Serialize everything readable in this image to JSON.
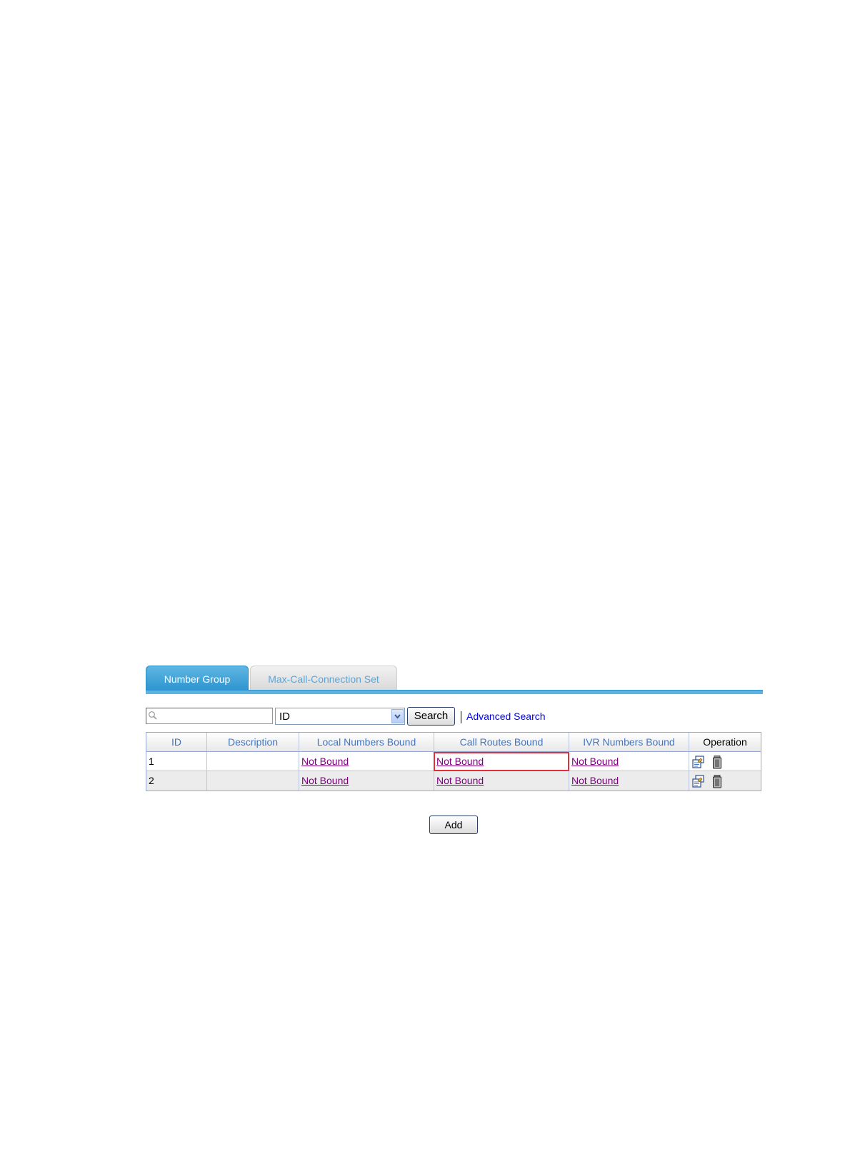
{
  "tabs": [
    {
      "label": "Number Group",
      "active": true
    },
    {
      "label": "Max-Call-Connection Set",
      "active": false
    }
  ],
  "search": {
    "value": "",
    "field_selected": "ID",
    "button_label": "Search",
    "advanced_label": "Advanced Search"
  },
  "table": {
    "columns": [
      "ID",
      "Description",
      "Local Numbers Bound",
      "Call Routes Bound",
      "IVR Numbers Bound",
      "Operation"
    ],
    "rows": [
      {
        "id": "1",
        "description": "",
        "local": "Not Bound",
        "routes": "Not Bound",
        "ivr": "Not Bound",
        "operations": [
          "edit-icon",
          "delete-icon"
        ]
      },
      {
        "id": "2",
        "description": "",
        "local": "Not Bound",
        "routes": "Not Bound",
        "ivr": "Not Bound",
        "operations": [
          "edit-icon",
          "delete-icon"
        ]
      }
    ]
  },
  "add_button_label": "Add",
  "colors": {
    "tab_active": "#2c95cf",
    "header_text": "#3f76c6",
    "link_visited": "#800080",
    "highlight": "#e0303a"
  }
}
